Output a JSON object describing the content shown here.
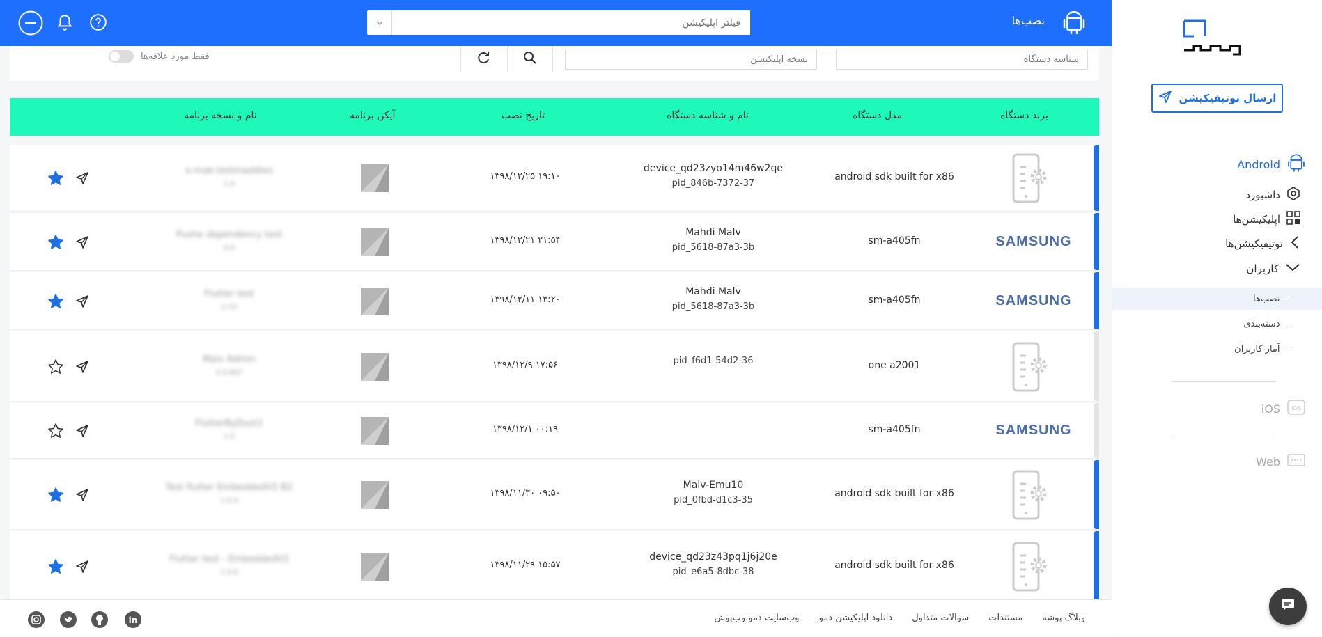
{
  "colors": {
    "primary": "#1f6fff",
    "accent_header": "#1ef9b9",
    "active_bar": "#1f6fe0",
    "inactive_bar": "#e5e5e5"
  },
  "topbar": {
    "title": "نصب‌ها",
    "filter_placeholder": "فیلتر اپلیکیشن",
    "icons": [
      "android-icon",
      "user-circle-icon",
      "bell-icon",
      "help-icon"
    ]
  },
  "filters": {
    "device_id_placeholder": "شناسه دستگاه",
    "app_version_placeholder": "نسخه اپلیکیشن",
    "favorites_label": "فقط مورد علاقه‌ها",
    "favorites_only": false
  },
  "sidebar": {
    "send_notification": "ارسال نوتیفیکیشن",
    "android": "Android",
    "menu": [
      {
        "label": "داشبورد",
        "icon": "dashboard-icon"
      },
      {
        "label": "اپلیکیشن‌ها",
        "icon": "apps-icon"
      },
      {
        "label": "نوتیفیکیشن‌ها",
        "icon": "chevron-left-icon"
      },
      {
        "label": "کاربران",
        "icon": "chevron-down-icon"
      }
    ],
    "submenu": [
      {
        "label": "نصب‌ها",
        "active": true
      },
      {
        "label": "دسته‌بندی",
        "active": false
      },
      {
        "label": "آمار کاربران",
        "active": false
      }
    ],
    "ios": "iOS",
    "web": "Web"
  },
  "table": {
    "headers": [
      "برند دستگاه",
      "مدل دستگاه",
      "نام و شناسه دستگاه",
      "تاریخ نصب",
      "آیکن برنامه",
      "نام و نسخه برنامه"
    ],
    "rows": [
      {
        "brand": "generic",
        "model": "android sdk built for x86",
        "device_name": "device_qd23zyo14m46w2qe",
        "device_id": "pid_846b-7372-37",
        "date": "۱۳۹۸/۱۲/۲۵ ۱۹:۱۰",
        "app_name": "x-mak-testmaddies",
        "app_version": "1.0",
        "favorite": true,
        "active": true
      },
      {
        "brand": "SAMSUNG",
        "model": "sm-a405fn",
        "device_name": "Mahdi Malv",
        "device_id": "pid_5618-87a3-3b",
        "date": "۱۳۹۸/۱۲/۲۱ ۲۱:۵۴",
        "app_name": "Pushe dependency test",
        "app_version": "0.0",
        "favorite": true,
        "active": true
      },
      {
        "brand": "SAMSUNG",
        "model": "sm-a405fn",
        "device_name": "Mahdi Malv",
        "device_id": "pid_5618-87a3-3b",
        "date": "۱۳۹۸/۱۲/۱۱ ۱۳:۲۰",
        "app_name": "Flutter test",
        "app_version": "2.10",
        "favorite": true,
        "active": true
      },
      {
        "brand": "generic",
        "model": "one a2001",
        "device_name": "",
        "device_id": "pid_f6d1-54d2-36",
        "date": "۱۳۹۸/۱۲/۹ ۱۷:۵۶",
        "app_name": "Malv Admin",
        "app_version": "0.0.897",
        "favorite": false,
        "active": false
      },
      {
        "brand": "SAMSUNG",
        "model": "sm-a405fn",
        "device_name": "",
        "device_id": "",
        "date": "۱۳۹۸/۱۲/۱ ۰۰:۱۹",
        "app_name": "FlutterByDust1",
        "app_version": "1.0",
        "favorite": false,
        "active": false
      },
      {
        "brand": "generic",
        "model": "android sdk built for x86",
        "device_name": "Malv-Emu10",
        "device_id": "pid_0fbd-d1c3-35",
        "date": "۱۳۹۸/۱۱/۳۰ ۰۹:۵۰",
        "app_name": "Test flutter EmbeddedV2 B2",
        "app_version": "1.0.0",
        "favorite": true,
        "active": true
      },
      {
        "brand": "generic",
        "model": "android sdk built for x86",
        "device_name": "device_qd23z43pq1j6j20e",
        "device_id": "pid_e6a5-8dbc-38",
        "date": "۱۳۹۸/۱۱/۲۹ ۱۵:۵۷",
        "app_name": "Flutter test - EmbeddedV2",
        "app_version": "1.0.0",
        "favorite": true,
        "active": true
      }
    ]
  },
  "footer": {
    "links": [
      "وبلاگ پوشه",
      "مستندات",
      "سوالات متداول",
      "دانلود اپلیکیشن دمو",
      "وب‌سایت دمو وب‌پوش"
    ],
    "social": [
      "linkedin-icon",
      "github-icon",
      "twitter-icon",
      "instagram-icon"
    ]
  }
}
